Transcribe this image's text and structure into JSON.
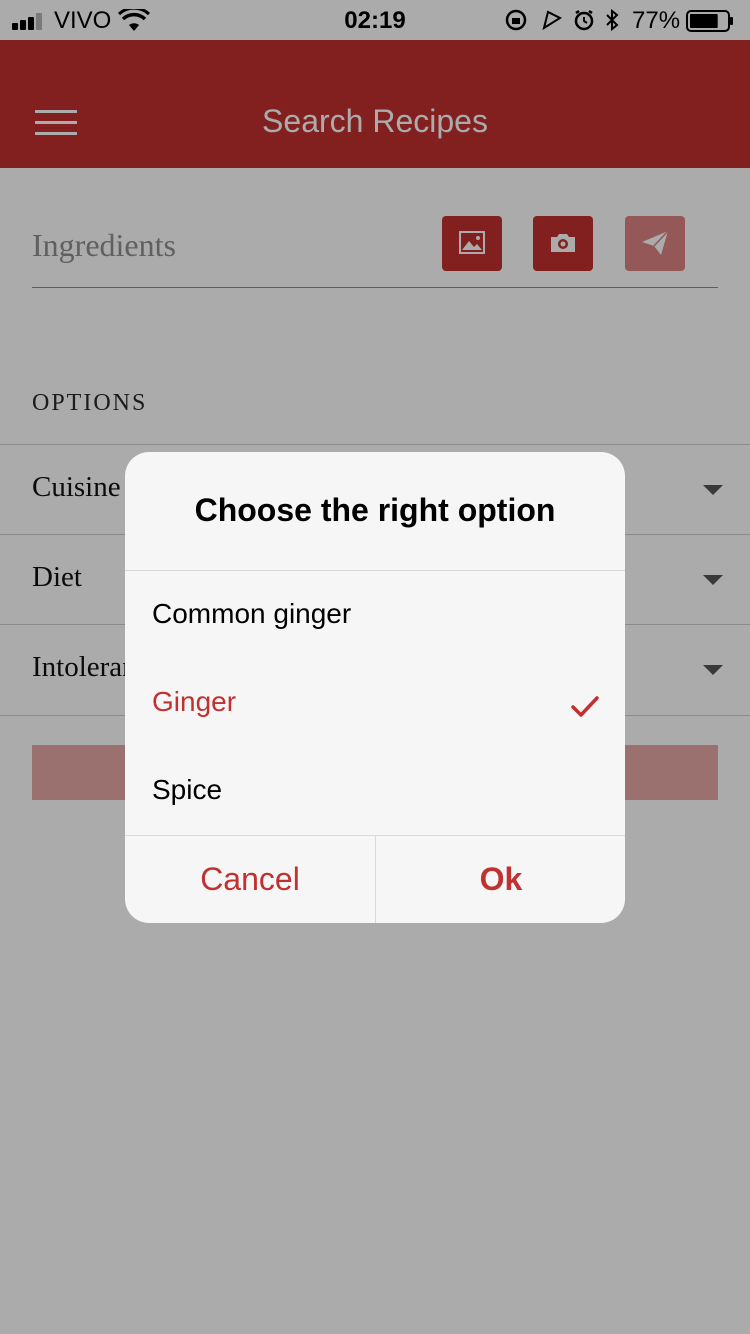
{
  "status_bar": {
    "carrier": "VIVO",
    "time": "02:19",
    "battery_percent": "77%",
    "battery_level": 0.77,
    "icons": [
      "signal-icon",
      "wifi-icon",
      "rotation-lock-icon",
      "location-icon",
      "alarm-icon",
      "bluetooth-icon",
      "battery-icon"
    ]
  },
  "app_bar": {
    "title": "Search Recipes",
    "menu_icon": "menu-icon"
  },
  "search": {
    "placeholder": "Ingredients",
    "buttons": [
      "gallery-icon",
      "camera-icon",
      "send-icon"
    ]
  },
  "options": {
    "header": "OPTIONS",
    "rows": [
      {
        "label": "Cuisine"
      },
      {
        "label": "Diet"
      },
      {
        "label": "Intoleran"
      }
    ]
  },
  "dialog": {
    "title": "Choose the right option",
    "options": [
      {
        "label": "Common ginger",
        "selected": false
      },
      {
        "label": "Ginger",
        "selected": true
      },
      {
        "label": "Spice",
        "selected": false
      }
    ],
    "cancel_label": "Cancel",
    "ok_label": "Ok"
  },
  "colors": {
    "brand": "#c0312f",
    "brand_disabled": "#dc8482",
    "overlay": "rgba(0,0,0,0.33)",
    "dialog_bg": "#f6f6f6"
  }
}
